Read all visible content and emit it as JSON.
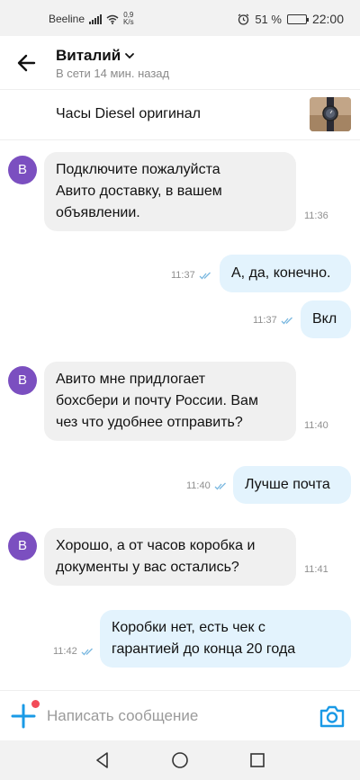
{
  "status_bar": {
    "carrier": "Beeline",
    "net_speed_value": "0,9",
    "net_speed_unit": "K/s",
    "battery_percent": "51 %",
    "battery_level": 0.51,
    "time": "22:00"
  },
  "header": {
    "contact_name": "Виталий",
    "last_seen": "В сети 14 мин. назад"
  },
  "listing": {
    "title": "Часы Diesel оригинал"
  },
  "messages": [
    {
      "dir": "in",
      "avatar_letter": "В",
      "lines": [
        "Подключите пожалуйста",
        "Авито доставку, в вашем",
        "объявлении."
      ],
      "time": "11:36"
    },
    {
      "dir": "out",
      "lines": [
        "А, да, конечно."
      ],
      "time": "11:37"
    },
    {
      "dir": "out",
      "lines": [
        "Вкл"
      ],
      "time": "11:37"
    },
    {
      "dir": "in",
      "avatar_letter": "В",
      "lines": [
        "Авито мне придлогает",
        "бохсбери и почту России. Вам",
        "чез что удобнее отправить?"
      ],
      "time": "11:40"
    },
    {
      "dir": "out",
      "lines": [
        "Лучше почта"
      ],
      "time": "11:40"
    },
    {
      "dir": "in",
      "avatar_letter": "В",
      "lines": [
        "Хорошо, а от часов коробка и",
        "документы у вас остались?"
      ],
      "time": "11:41"
    },
    {
      "dir": "out",
      "lines": [
        "Коробки нет, есть чек с",
        "гарантией до конца 20 года"
      ],
      "time": "11:42"
    }
  ],
  "composer": {
    "placeholder": "Написать сообщение"
  },
  "colors": {
    "avatar": "#7b4fc0",
    "outgoing_bubble": "#e3f3fd",
    "incoming_bubble": "#f0f0f0",
    "accent": "#1a9ae6",
    "notification_dot": "#f24b58"
  },
  "icons": {
    "back": "arrow-left-icon",
    "chevron": "chevron-down-icon",
    "read": "double-check-icon",
    "add": "plus-icon",
    "camera": "camera-icon",
    "nav_back": "triangle-back-icon",
    "nav_home": "circle-home-icon",
    "nav_recent": "square-recent-icon"
  }
}
